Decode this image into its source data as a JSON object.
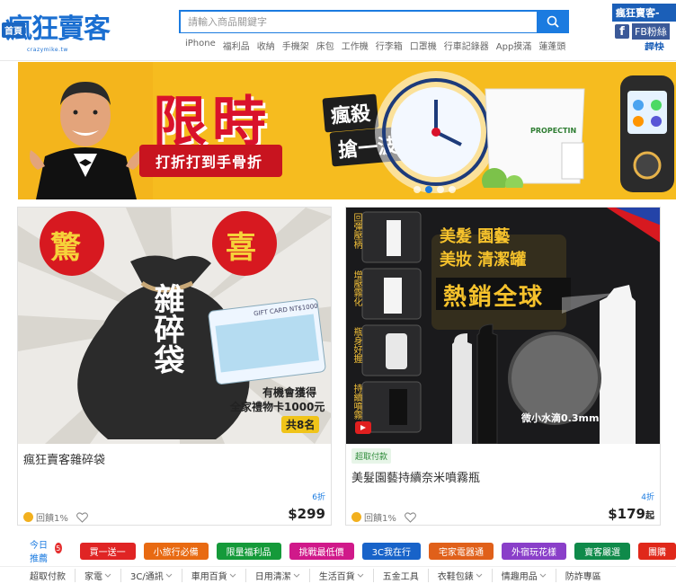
{
  "header": {
    "home_badge": "首頁",
    "logo_text": "瘋狂賣客",
    "logo_sub": "crazymike.tw",
    "search_placeholder": "請輸入商品關鍵字",
    "hot_keywords": [
      "iPhone",
      "福利品",
      "收納",
      "手機架",
      "床包",
      "工作機",
      "行李箱",
      "口罩機",
      "行車記錄器",
      "App摸滿",
      "蓮蓬頭"
    ],
    "fb": {
      "title": "瘋狂賣客-",
      "label": "FB粉絲",
      "sub": "趕快"
    }
  },
  "banner": {
    "title": "限時",
    "line1": "瘋殺",
    "line2": "搶一波",
    "ribbon": "打折打到手骨折",
    "brand": "PROPECTIN",
    "slide_count": 4,
    "active_slide": 1
  },
  "products": [
    {
      "image_title": "雜碎袋",
      "corner_left": "驚",
      "corner_right": "喜",
      "card_text": "GIFT CARD NT$1000",
      "promo1": "有機會獲得",
      "promo2": "全家禮物卡1000元",
      "promo3": "共8名",
      "badge": "",
      "title": "瘋狂賣客雜碎袋",
      "discount": "6折",
      "price": "$299",
      "price_suffix": "",
      "cashback": "回饋1%"
    },
    {
      "image_left_labels": [
        "回彈壓柄",
        "增壓霧化",
        "瓶身好握",
        "持續噴霧"
      ],
      "headline1": "美髮 園藝",
      "headline2": "美妝 清潔罐",
      "headline3": "熱銷全球",
      "mist_label": "微小水滴0.3mm",
      "badge": "超取付款",
      "title": "美髮園藝持續奈米噴霧瓶",
      "discount": "4折",
      "price": "$179",
      "price_suffix": "起",
      "cashback": "回饋1%"
    }
  ],
  "promo_tags": {
    "title": "今日推薦",
    "count": "5",
    "items": [
      {
        "label": "買一送一",
        "color": "#e02424"
      },
      {
        "label": "小旅行必備",
        "color": "#e86a12"
      },
      {
        "label": "限量福利品",
        "color": "#159a3a"
      },
      {
        "label": "挑戰最低價",
        "color": "#d0198a"
      },
      {
        "label": "3C我在行",
        "color": "#1863c9"
      },
      {
        "label": "宅家電器通",
        "color": "#e0601a"
      },
      {
        "label": "外宿玩花樣",
        "color": "#8a3fc9"
      },
      {
        "label": "賣客嚴選",
        "color": "#0f8a4a"
      },
      {
        "label": "團購",
        "color": "#e0281a"
      }
    ]
  },
  "categories": [
    "超取付款",
    "家電",
    "3C/通訊",
    "車用百貨",
    "日用清潔",
    "生活百貨",
    "五金工具",
    "衣鞋包錶",
    "情趣用品",
    "防詐專區"
  ],
  "colors": {
    "brand_blue": "#1b7be0",
    "banner_yellow": "#f6bc1f",
    "accent_red": "#d9122b"
  }
}
